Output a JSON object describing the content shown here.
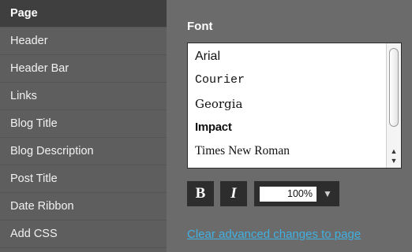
{
  "sidebar": {
    "items": [
      {
        "label": "Page"
      },
      {
        "label": "Header"
      },
      {
        "label": "Header Bar"
      },
      {
        "label": "Links"
      },
      {
        "label": "Blog Title"
      },
      {
        "label": "Blog Description"
      },
      {
        "label": "Post Title"
      },
      {
        "label": "Date Ribbon"
      },
      {
        "label": "Add CSS"
      }
    ],
    "selected": "Page"
  },
  "font_panel": {
    "heading": "Font",
    "options": [
      {
        "label": "Arial",
        "family": "Liberation Sans",
        "fallback": "sans-serif"
      },
      {
        "label": "Courier",
        "family": "Liberation Mono",
        "fallback": "monospace"
      },
      {
        "label": "Georgia",
        "family": "DejaVu Serif",
        "fallback": "serif"
      },
      {
        "label": "Impact",
        "family": "Liberation Sans",
        "fallback": "sans-serif"
      },
      {
        "label": "Times New Roman",
        "family": "Liberation Serif",
        "fallback": "serif"
      }
    ],
    "scroll_up_icon": "chevron-up-icon",
    "scroll_down_icon": "chevron-down-icon"
  },
  "toolbar": {
    "bold_label": "B",
    "italic_label": "I",
    "size_value": "100%",
    "size_dropdown_icon": "chevron-down-icon"
  },
  "clear_link": "Clear advanced changes to page",
  "colors": {
    "background": "#6b6b6b",
    "sidebar": "#5e5e5e",
    "sidebar_active": "#3f3f3f",
    "link": "#3fb1e3"
  }
}
